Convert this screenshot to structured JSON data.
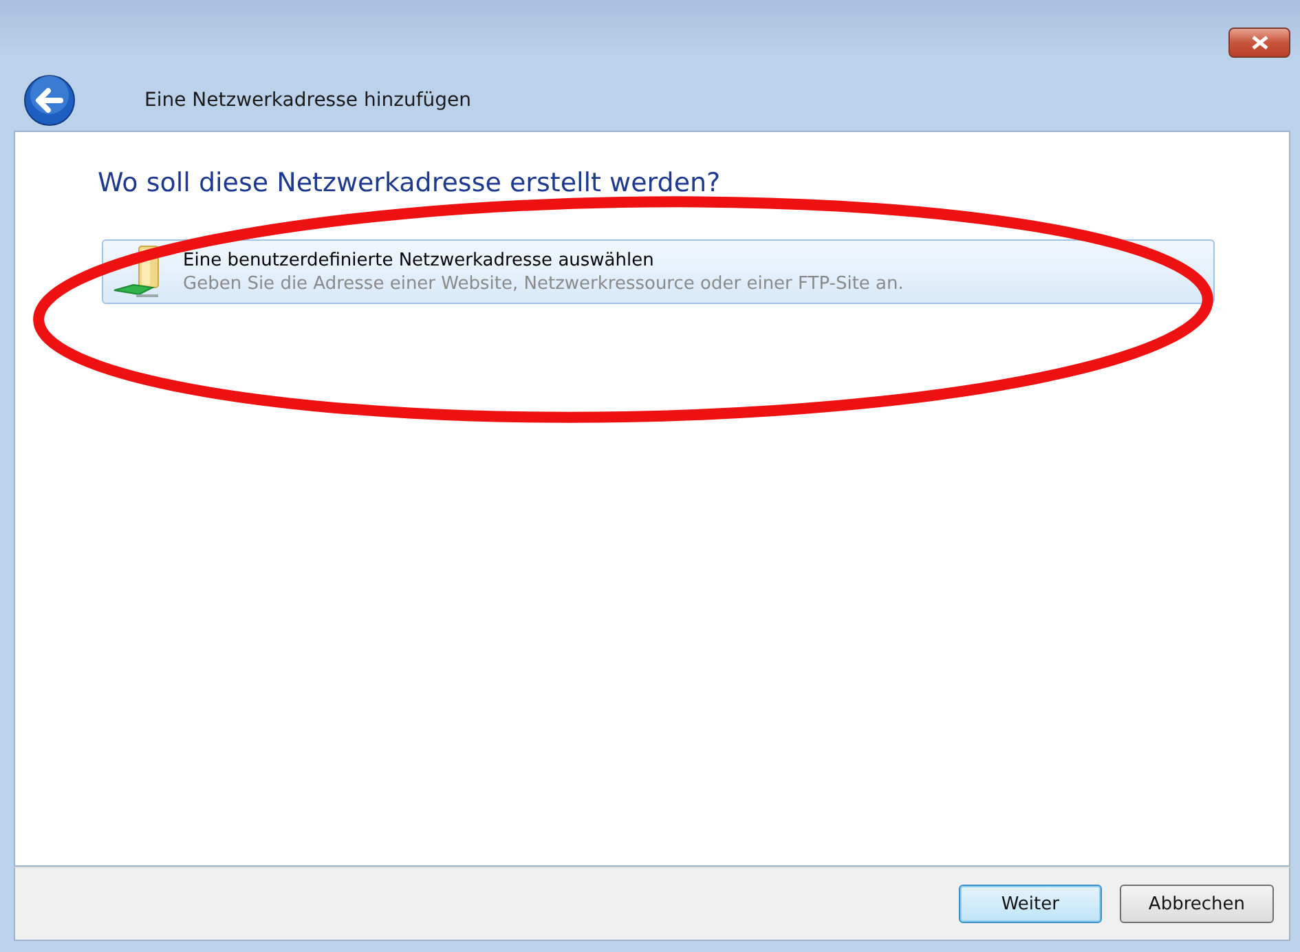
{
  "window": {
    "title": "Eine Netzwerkadresse hinzufügen"
  },
  "heading": "Wo soll diese Netzwerkadresse erstellt werden?",
  "options": [
    {
      "title": "Eine benutzerdefinierte Netzwerkadresse auswählen",
      "description": "Geben Sie die Adresse einer Website, Netzwerkressource oder einer FTP-Site an.",
      "selected": true
    }
  ],
  "annotation": {
    "kind": "ellipse",
    "color": "#ee1111"
  },
  "buttons": [
    {
      "label": "Weiter",
      "default": true
    },
    {
      "label": "Abbrechen",
      "default": false
    }
  ]
}
